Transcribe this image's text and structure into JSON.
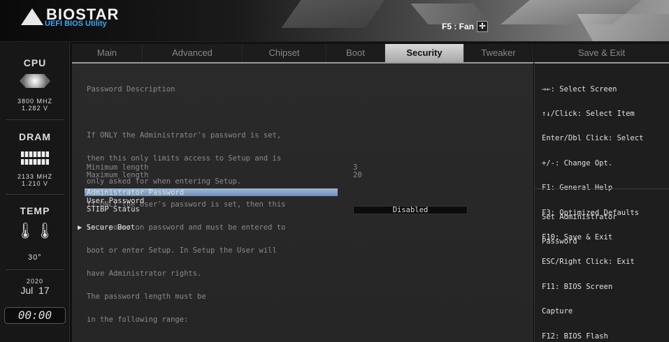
{
  "header": {
    "logo_text": "BIOSTAR",
    "subtitle": "UEFI BIOS Utility",
    "f5_label": "F5 : Fan",
    "fan_icon": "fan-icon"
  },
  "sidebar": {
    "cpu_title": "CPU",
    "cpu_freq": "3800 MHZ",
    "cpu_volt": "1.282 V",
    "dram_title": "DRAM",
    "dram_freq": "2133 MHZ",
    "dram_volt": "1.210 V",
    "temp_title": "TEMP",
    "temp_value": "30°",
    "year": "2020",
    "date": "Jul  17",
    "time": "00:00"
  },
  "tabs": [
    "Main",
    "Advanced",
    "Chipset",
    "Boot",
    "Security",
    "Tweaker"
  ],
  "active_tab": "Security",
  "exit_tab": "Save & Exit",
  "main": {
    "description": [
      "Password Description",
      "",
      "If ONLY the Administrator's password is set,",
      "then this only limits access to Setup and is",
      "only asked for when entering Setup.",
      "If ONLY the User's password is set, then this",
      "is a power on password and must be entered to",
      "boot or enter Setup. In Setup the User will",
      "have Administrator rights.",
      "The password length must be",
      "in the following range:"
    ],
    "min_label": "Minimum length",
    "min_value": "3",
    "max_label": "Maximum length",
    "max_value": "20",
    "admin_password": "Administrator Password",
    "user_password": "User Password",
    "stibp_label": "STIBP Status",
    "stibp_value": "Disabled",
    "secure_boot": "▶ Secure Boot"
  },
  "help": {
    "keys": [
      "→←: Select Screen",
      "↑↓/Click: Select Item",
      "Enter/Dbl Click: Select",
      "+/-: Change Opt.",
      "F1: General Help",
      "F3: Optimized Defaults",
      "F10: Save & Exit",
      "ESC/Right Click: Exit",
      "F11: BIOS Screen",
      "Capture",
      "F12: BIOS Flash"
    ],
    "item_help": [
      "Set Administrator",
      "Password"
    ]
  },
  "colors": {
    "selection": "#7f9fc4",
    "active_tab": "#c4c4c4",
    "logo_sub": "#3fa9f5"
  }
}
